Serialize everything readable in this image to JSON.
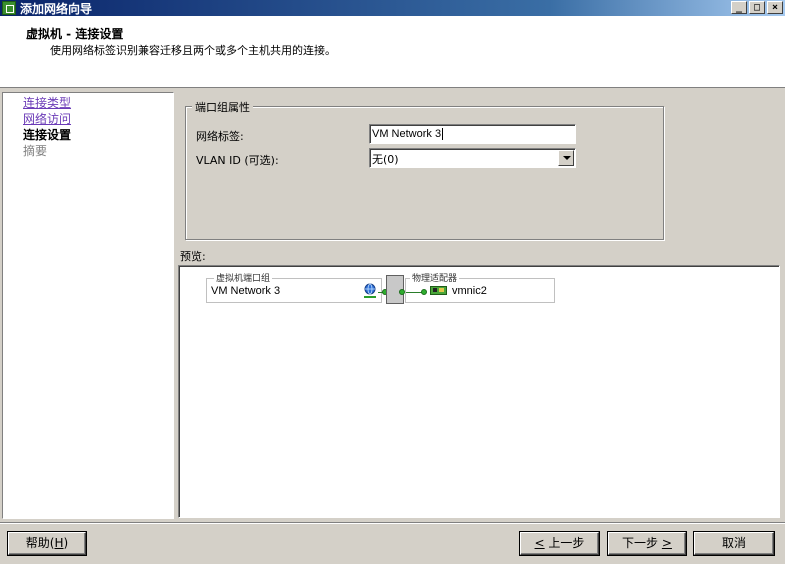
{
  "window": {
    "title": "添加网络向导",
    "controls": {
      "minimize": "_",
      "maximize": "□",
      "close": "×"
    }
  },
  "header": {
    "title": "虚拟机 - 连接设置",
    "subtitle": "使用网络标签识别兼容迁移且两个或多个主机共用的连接。"
  },
  "nav": {
    "items": [
      {
        "label": "连接类型",
        "state": "link"
      },
      {
        "label": "网络访问",
        "state": "link"
      },
      {
        "label": "连接设置",
        "state": "current"
      },
      {
        "label": "摘要",
        "state": "disabled"
      }
    ]
  },
  "port_group_props": {
    "legend": "端口组属性",
    "network_label": {
      "label": "网络标签:",
      "value": "VM Network 3"
    },
    "vlan_id": {
      "label": "VLAN ID (可选):",
      "selected": "无(0)"
    }
  },
  "preview": {
    "label": "预览:",
    "vm_port_group_title": "虚拟机端口组",
    "vm_port_group_name": "VM Network 3",
    "physical_adapters_title": "物理适配器",
    "nic_name": "vmnic2"
  },
  "footer": {
    "help": {
      "text": "帮助(",
      "key": "H",
      "suffix": ")"
    },
    "back": {
      "prefix": "",
      "key": "<",
      "text": " 上一步"
    },
    "next": {
      "text": "下一步 ",
      "key": ">"
    },
    "cancel": "取消"
  },
  "colors": {
    "titlebar_start": "#0a246a",
    "titlebar_end": "#a6caf0",
    "link": "#6b3bb7",
    "wire": "#2a7d2a"
  }
}
